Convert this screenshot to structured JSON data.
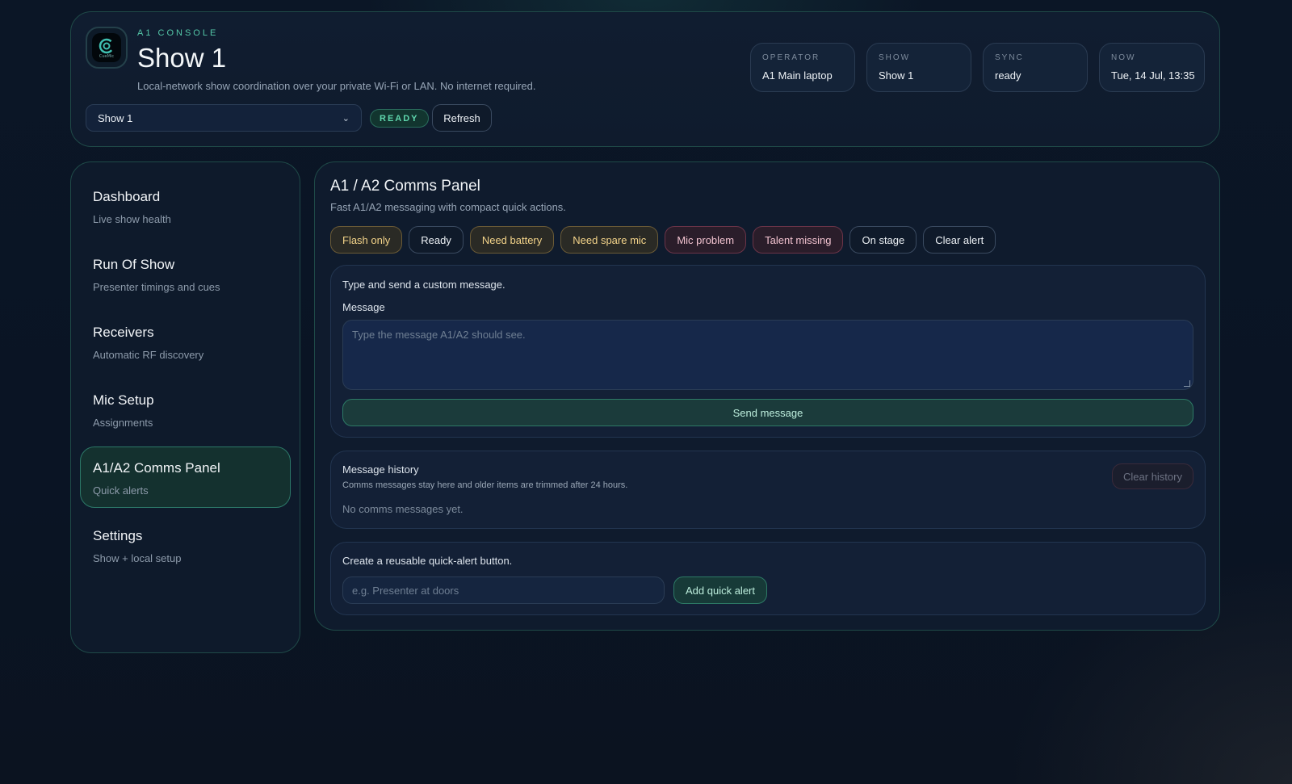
{
  "header": {
    "logo_icon": "cueline-logo-icon",
    "logo_text": "CueMic",
    "eyebrow": "A1 CONSOLE",
    "title": "Show 1",
    "subtitle": "Local-network show coordination over your private Wi-Fi or LAN. No internet required.",
    "show_select_value": "Show 1",
    "status_badge": "READY",
    "refresh_label": "Refresh",
    "stats": [
      {
        "label": "OPERATOR",
        "value": "A1 Main laptop"
      },
      {
        "label": "SHOW",
        "value": "Show 1"
      },
      {
        "label": "SYNC",
        "value": "ready"
      },
      {
        "label": "NOW",
        "value": "Tue, 14 Jul, 13:35"
      }
    ]
  },
  "sidebar": {
    "items": [
      {
        "title": "Dashboard",
        "sub": "Live show health"
      },
      {
        "title": "Run Of Show",
        "sub": "Presenter timings and cues"
      },
      {
        "title": "Receivers",
        "sub": "Automatic RF discovery"
      },
      {
        "title": "Mic Setup",
        "sub": "Assignments"
      },
      {
        "title": "A1/A2 Comms Panel",
        "sub": "Quick alerts",
        "active": true
      },
      {
        "title": "Settings",
        "sub": "Show + local setup"
      }
    ]
  },
  "panel": {
    "title": "A1 / A2 Comms Panel",
    "subtitle": "Fast A1/A2 messaging with compact quick actions.",
    "chips": [
      {
        "label": "Flash only",
        "tone": "warn"
      },
      {
        "label": "Ready",
        "tone": "neutral"
      },
      {
        "label": "Need battery",
        "tone": "warn"
      },
      {
        "label": "Need spare mic",
        "tone": "warn"
      },
      {
        "label": "Mic problem",
        "tone": "danger"
      },
      {
        "label": "Talent missing",
        "tone": "danger"
      },
      {
        "label": "On stage",
        "tone": "neutral"
      },
      {
        "label": "Clear alert",
        "tone": "neutral"
      }
    ],
    "compose": {
      "intro": "Type and send a custom message.",
      "field_label": "Message",
      "placeholder": "Type the message A1/A2 should see.",
      "send_label": "Send message"
    },
    "history": {
      "title": "Message history",
      "note": "Comms messages stay here and older items are trimmed after 24 hours.",
      "empty": "No comms messages yet.",
      "clear_label": "Clear history"
    },
    "quick_alert": {
      "intro": "Create a reusable quick-alert button.",
      "placeholder": "e.g. Presenter at doors",
      "add_label": "Add quick alert"
    }
  },
  "colors": {
    "accent": "#54c7a8",
    "warn": "#f4d48a",
    "danger": "#f2c3d0",
    "border": "#1f4a48"
  }
}
